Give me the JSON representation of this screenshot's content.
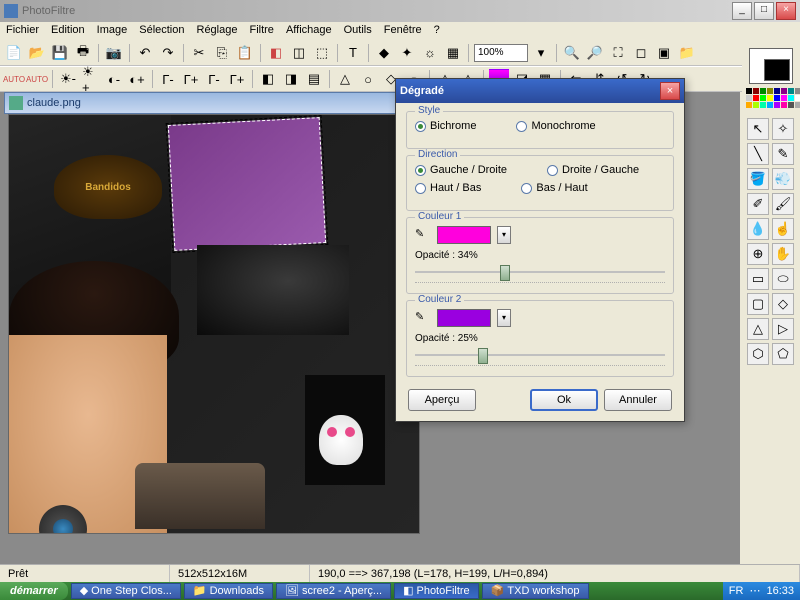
{
  "app": {
    "title": "PhotoFiltre"
  },
  "menu": [
    "Fichier",
    "Edition",
    "Image",
    "Sélection",
    "Réglage",
    "Filtre",
    "Affichage",
    "Outils",
    "Fenêtre",
    "?"
  ],
  "zoom": "100%",
  "document": {
    "title": "claude.png",
    "patch_text": "Bandidos"
  },
  "dialog": {
    "title": "Dégradé",
    "style_legend": "Style",
    "style_bichrome": "Bichrome",
    "style_monochrome": "Monochrome",
    "direction_legend": "Direction",
    "dir_lr": "Gauche / Droite",
    "dir_rl": "Droite / Gauche",
    "dir_tb": "Haut / Bas",
    "dir_bt": "Bas / Haut",
    "color1_legend": "Couleur 1",
    "color1_hex": "#ff00dd",
    "opacity1_label": "Opacité : 34%",
    "opacity1_pct": 34,
    "color2_legend": "Couleur 2",
    "color2_hex": "#9a00e0",
    "opacity2_label": "Opacité : 25%",
    "opacity2_pct": 25,
    "btn_preview": "Aperçu",
    "btn_ok": "Ok",
    "btn_cancel": "Annuler"
  },
  "palette_colors": [
    "#000",
    "#800",
    "#080",
    "#880",
    "#008",
    "#808",
    "#088",
    "#888",
    "#ccc",
    "#f00",
    "#0f0",
    "#ff0",
    "#00f",
    "#f0f",
    "#0ff",
    "#fff",
    "#fa0",
    "#af0",
    "#0fa",
    "#0af",
    "#a0f",
    "#f0a",
    "#555",
    "#aaa"
  ],
  "status": {
    "ready": "Prêt",
    "dimensions": "512x512x16M",
    "coords": "190,0 ==> 367,198 (L=178, H=199, L/H=0,894)"
  },
  "taskbar": {
    "start": "démarrer",
    "items": [
      "One Step Clos...",
      "Downloads",
      "scree2 - Aperç...",
      "PhotoFiltre",
      "TXD workshop"
    ],
    "lang": "FR",
    "clock": "16:33"
  }
}
